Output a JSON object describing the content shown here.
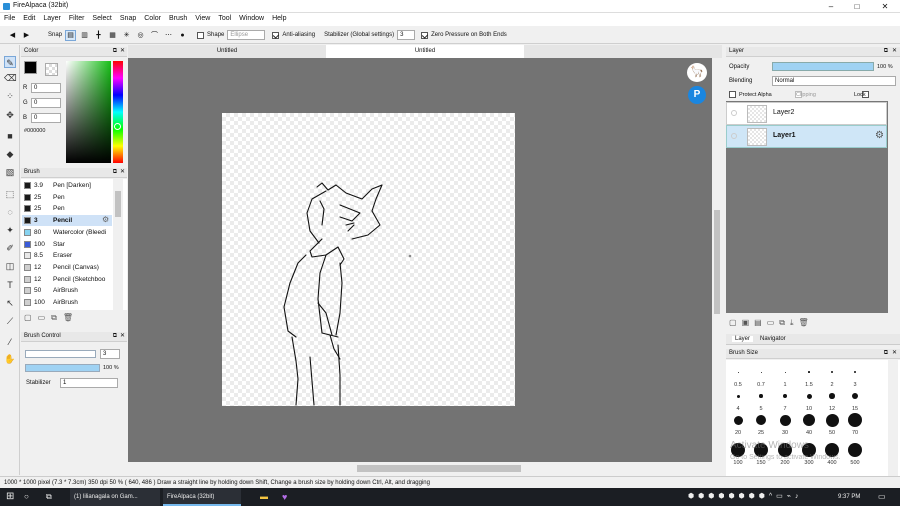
{
  "window": {
    "title": "FireAlpaca (32bit)",
    "minimize": "–",
    "maximize": "□",
    "close": "✕"
  },
  "menu": [
    "File",
    "Edit",
    "Layer",
    "Filter",
    "Select",
    "Snap",
    "Color",
    "Brush",
    "View",
    "Tool",
    "Window",
    "Help"
  ],
  "toolopts": {
    "snap_label": "Snap",
    "shape_label": "Shape",
    "shape_value": "Ellipse",
    "antialias_label": "Anti-aliasing",
    "stabilizer_label": "Stabilizer (Global settings)",
    "stabilizer_value": "3",
    "zero_pressure_label": "Zero Pressure on Both Ends"
  },
  "tabs": [
    "Untitled",
    "Untitled"
  ],
  "color_panel": {
    "title": "Color",
    "r_label": "R",
    "g_label": "G",
    "b_label": "B",
    "r": "0",
    "g": "0",
    "b": "0",
    "hex": "#000000",
    "fg": "#000000"
  },
  "brush_panel": {
    "title": "Brush",
    "items": [
      {
        "size": "3.9",
        "name": "Pen [Darken]",
        "color": "#1a1a1a"
      },
      {
        "size": "25",
        "name": "Pen",
        "color": "#1a1a1a"
      },
      {
        "size": "25",
        "name": "Pen",
        "color": "#1a1a1a"
      },
      {
        "size": "3",
        "name": "Pencil",
        "color": "#1a1a1a"
      },
      {
        "size": "80",
        "name": "Watercolor (Bleedi",
        "color": "#87d3f0"
      },
      {
        "size": "100",
        "name": "Star",
        "color": "#3a5bd8"
      },
      {
        "size": "8.5",
        "name": "Eraser",
        "color": "#e8e8e8"
      },
      {
        "size": "12",
        "name": "Pencil (Canvas)",
        "color": "#cfcfcf"
      },
      {
        "size": "12",
        "name": "Pencil (Sketchboo",
        "color": "#cfcfcf"
      },
      {
        "size": "50",
        "name": "AirBrush",
        "color": "#cfcfcf"
      },
      {
        "size": "100",
        "name": "AirBrush",
        "color": "#cfcfcf"
      }
    ],
    "selected_index": 3
  },
  "brush_control": {
    "title": "Brush Control",
    "size": "3",
    "opacity": "100 %",
    "opacity_pct": 100,
    "stabilizer_label": "Stabilizer",
    "stabilizer_value": "1"
  },
  "layer_panel": {
    "title": "Layer",
    "opacity_label": "Opacity",
    "opacity_value": "100 %",
    "opacity_pct": 100,
    "blending_label": "Blending",
    "blending_value": "Normal",
    "protect_alpha": "Protect Alpha",
    "clipping": "Clipping",
    "lock": "Lock",
    "layers": [
      {
        "name": "Layer2",
        "selected": false
      },
      {
        "name": "Layer1",
        "selected": true
      }
    ]
  },
  "side_tabs": [
    "Layer",
    "Navigator"
  ],
  "brush_size_panel": {
    "title": "Brush Size",
    "rows": [
      [
        "0.5",
        "0.7",
        "1",
        "1.5",
        "2",
        "3"
      ],
      [
        "4",
        "5",
        "7",
        "10",
        "12",
        "15"
      ],
      [
        "20",
        "25",
        "30",
        "40",
        "50",
        "70"
      ],
      [
        "100",
        "150",
        "200",
        "300",
        "400",
        "500"
      ]
    ]
  },
  "watermark": {
    "line1": "Activate Windows",
    "line2": "Go to Settings to activate Windows."
  },
  "status": {
    "size": "1000 * 1000 pixel",
    "physical": "(7.3 * 7.3cm)",
    "dpi": "350 dpi",
    "zoom": "50 %",
    "coords": "( 640, 486 )",
    "hint": "Draw a straight line by holding down Shift, Change a brush size by holding down Ctrl, Alt, and dragging"
  },
  "taskbar": {
    "app1": "(1) lilianagala on Gam...",
    "app2": "FireAlpaca (32bit)",
    "time": "9:37 PM"
  }
}
